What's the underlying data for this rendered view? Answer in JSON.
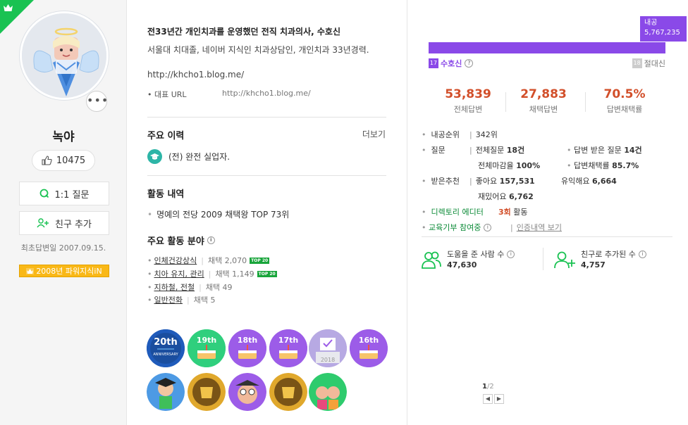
{
  "profile": {
    "nickname": "녹야",
    "likes": "10475",
    "question_button": "1:1 질문",
    "friend_button": "친구 추가",
    "first_answer_date": "최초답변일 2007.09.15.",
    "power_badge": "2008년 파워지식iN",
    "more_label": "•••"
  },
  "intro": {
    "headline": "전33년간 개인치과를 운영했던 전직 치과의사, 수호신",
    "description": "서울대 치대졸, 네이버 지식인 치과상담인, 개인치과 33년경력.",
    "blog_url": "http://khcho1.blog.me/",
    "rep_url_label": "대표 URL",
    "rep_url_value": "http://khcho1.blog.me/"
  },
  "career": {
    "title": "주요 이력",
    "more": "더보기",
    "item": "(전) 완전 실업자."
  },
  "activity": {
    "title": "활동 내역",
    "item": "명예의 전당 2009 채택왕 TOP 73위"
  },
  "fields": {
    "title": "주요 활동 분야",
    "items": [
      {
        "name": "인체건강상식",
        "count": "채택 2,070",
        "badge": "TOP 20"
      },
      {
        "name": "치아 유지, 관리",
        "count": "채택 1,149",
        "badge": "TOP 20"
      },
      {
        "name": "지하철, 전철",
        "count": "채택 49",
        "badge": ""
      },
      {
        "name": "일반전화",
        "count": "채택 5",
        "badge": ""
      }
    ]
  },
  "badges": {
    "labels": [
      "20th",
      "19th",
      "18th",
      "17th",
      "2018",
      "16th"
    ],
    "anniversary_text": "ANNIVERSARY",
    "page": "1",
    "page_total": "/2",
    "prev": "◀",
    "next": "▶"
  },
  "rank": {
    "bar_label_title": "내공",
    "bar_label_value": "5,767,235",
    "current_num": "17",
    "current_name": "수호신",
    "next_num": "18",
    "next_name": "절대신",
    "progress_fraction": 1.0
  },
  "stats": [
    {
      "value": "53,839",
      "label": "전체답변"
    },
    {
      "value": "27,883",
      "label": "채택답변"
    },
    {
      "value": "70.5%",
      "label": "답변채택률"
    }
  ],
  "details": {
    "naegong_rank_label": "내공순위",
    "naegong_rank_value": "342위",
    "question_label": "질문",
    "total_q_label": "전체질문",
    "total_q_value": "18건",
    "answered_q_label": "답변 받은 질문",
    "answered_q_value": "14건",
    "closed_label": "전체마감율",
    "closed_value": "100%",
    "adopt_label": "답변채택률",
    "adopt_value": "85.7%",
    "recommend_label": "받은추천",
    "like_label": "좋아요",
    "like_value": "157,531",
    "useful_label": "유익해요",
    "useful_value": "6,664",
    "fun_label": "재밌어요",
    "fun_value": "6,762",
    "editor_label": "디렉토리 에디터",
    "editor_count": "3회",
    "editor_suffix": "활동",
    "edu_label": "교육기부 참여중",
    "edu_link": "인증내역 보기"
  },
  "social": {
    "helped_label": "도움을 준 사람 수",
    "helped_value": "47,630",
    "friend_label": "친구로 추가된 수",
    "friend_value": "4,757"
  },
  "colors": {
    "brand_green": "#19c252",
    "purple": "#8a49e8",
    "stat_red": "#d24f2a",
    "gold": "#f9b817"
  }
}
